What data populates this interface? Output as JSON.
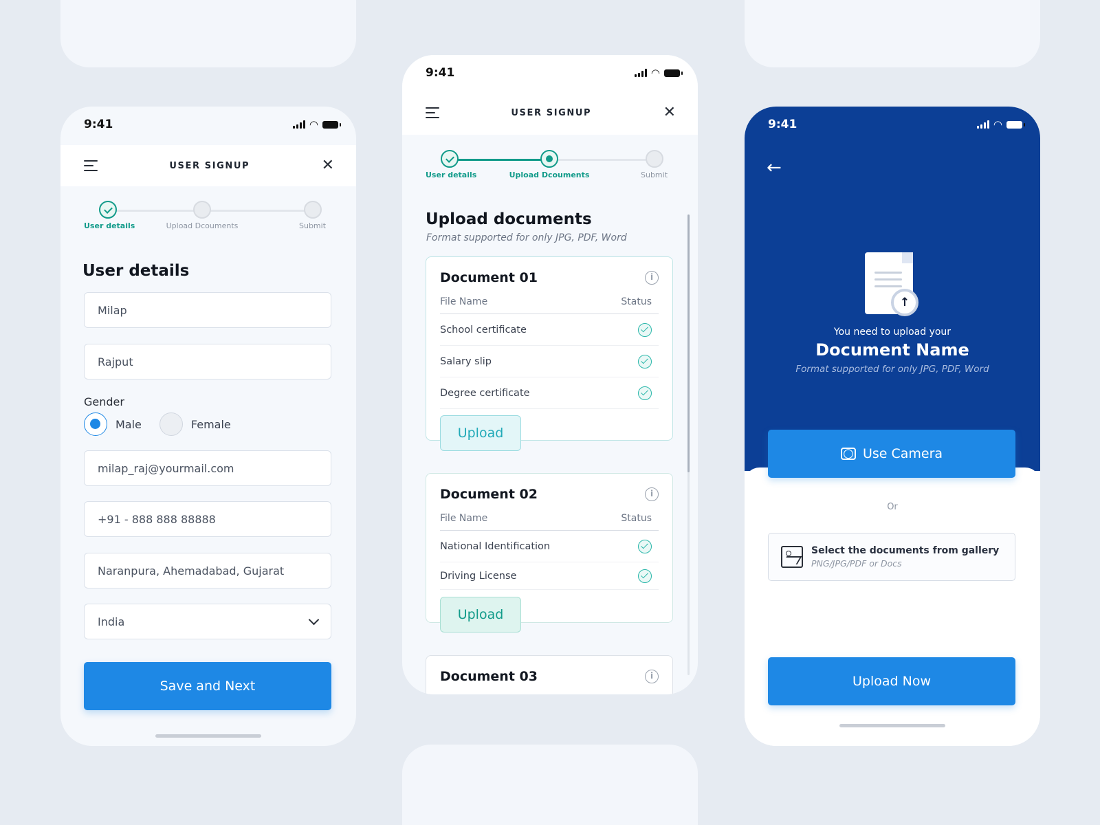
{
  "status": {
    "time": "9:41"
  },
  "screen1": {
    "header_title": "USER SIGNUP",
    "steps": [
      "User details",
      "Upload Dcouments",
      "Submit"
    ],
    "heading": "User details",
    "first_name": "Milap",
    "last_name": "Rajput",
    "gender_label": "Gender",
    "gender_options": [
      "Male",
      "Female"
    ],
    "gender_selected": "Male",
    "email": "milap_raj@yourmail.com",
    "phone": "+91 - 888 888 88888",
    "address": "Naranpura, Ahemadabad, Gujarat",
    "country": "India",
    "save_button": "Save and Next"
  },
  "screen2": {
    "header_title": "USER SIGNUP",
    "steps": [
      "User details",
      "Upload Dcouments",
      "Submit"
    ],
    "heading": "Upload documents",
    "subtitle": "Format supported for only JPG, PDF, Word",
    "col_file": "File Name",
    "col_status": "Status",
    "documents": [
      {
        "name": "Document 01",
        "files": [
          "School certificate",
          "Salary slip",
          "Degree certificate"
        ],
        "upload_label": "Upload"
      },
      {
        "name": "Document 02",
        "files": [
          "National Identification",
          "Driving License"
        ],
        "upload_label": "Upload"
      },
      {
        "name": "Document 03"
      }
    ]
  },
  "screen3": {
    "prompt": "You need to upload your",
    "doc_name": "Document Name",
    "formats": "Format supported for only JPG, PDF, Word",
    "camera_button": "Use Camera",
    "or": "Or",
    "gallery_title": "Select the documents from gallery",
    "gallery_sub": "PNG/JPG/PDF or Docs",
    "upload_now": "Upload Now"
  },
  "colors": {
    "primary": "#1e88e5",
    "teal": "#129b8a",
    "navy": "#0c3f96",
    "background": "#e6ebf2"
  }
}
